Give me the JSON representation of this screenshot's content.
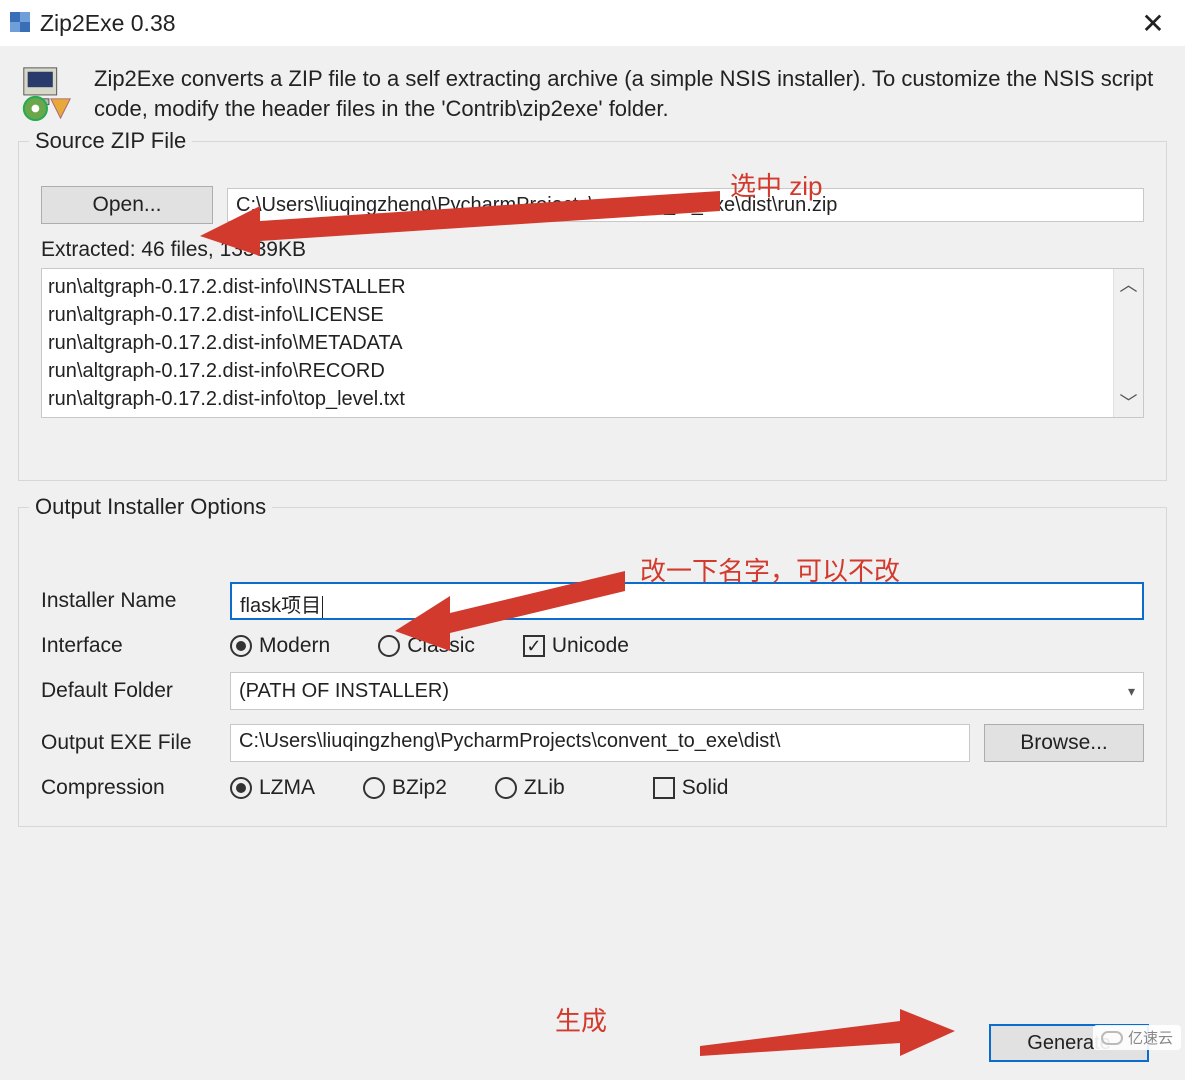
{
  "window": {
    "title": "Zip2Exe 0.38"
  },
  "intro": "Zip2Exe converts a ZIP file to a self extracting archive (a simple NSIS installer). To customize the NSIS script code, modify the header files in the 'Contrib\\zip2exe' folder.",
  "source": {
    "legend": "Source ZIP File",
    "open_label": "Open...",
    "path": "C:\\Users\\liuqingzheng\\PycharmProjects\\convent_to_exe\\dist\\run.zip",
    "extracted_label": "Extracted: 46 files, 13339KB",
    "files": [
      "run\\altgraph-0.17.2.dist-info\\INSTALLER",
      "run\\altgraph-0.17.2.dist-info\\LICENSE",
      "run\\altgraph-0.17.2.dist-info\\METADATA",
      "run\\altgraph-0.17.2.dist-info\\RECORD",
      "run\\altgraph-0.17.2.dist-info\\top_level.txt"
    ]
  },
  "options": {
    "legend": "Output Installer Options",
    "installer_name_label": "Installer Name",
    "installer_name_value": "flask项目",
    "interface_label": "Interface",
    "interface_modern": "Modern",
    "interface_classic": "Classic",
    "interface_unicode": "Unicode",
    "default_folder_label": "Default Folder",
    "default_folder_value": "(PATH OF INSTALLER)",
    "output_exe_label": "Output EXE File",
    "output_exe_value": "C:\\Users\\liuqingzheng\\PycharmProjects\\convent_to_exe\\dist\\",
    "browse_label": "Browse...",
    "compression_label": "Compression",
    "comp_lzma": "LZMA",
    "comp_bzip2": "BZip2",
    "comp_zlib": "ZLib",
    "comp_solid": "Solid"
  },
  "generate_label": "Generate",
  "annotations": {
    "a1": "选中 zip",
    "a2": "改一下名字，可以不改",
    "a3": "生成"
  },
  "watermark": "亿速云"
}
